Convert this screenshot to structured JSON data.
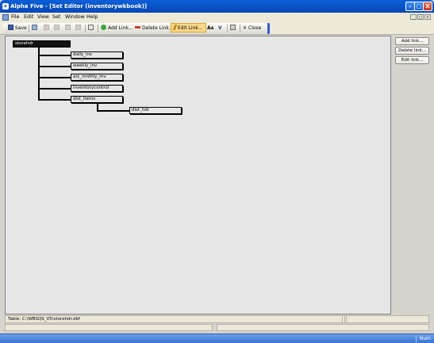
{
  "window": {
    "title": "Alpha Five - [Set Editor (inventorywkbook)]",
    "controls": {
      "minimize": "–",
      "maximize": "□",
      "close": "X"
    }
  },
  "menu": {
    "items": [
      "File",
      "Edit",
      "View",
      "Set",
      "Window",
      "Help"
    ],
    "mdi_controls": [
      "_",
      "◻",
      "x"
    ]
  },
  "toolbar": {
    "save": "Save",
    "add_link": "Add Link...",
    "delete_link": "Delete Link...",
    "edit_link": "Edit Link...",
    "close": "Close",
    "font_glyph": "Aᴀ",
    "v_glyph": "V"
  },
  "tree": {
    "root": "storehdr",
    "children": [
      "daily_inv",
      "weekly_inv",
      "arc_mnthly_inv",
      "inventorycontrol",
      "dist_items"
    ],
    "grandchild": "dist_hdr"
  },
  "side_buttons": {
    "add": "Add link...",
    "delete": "Delete link...",
    "edit": "Edit link..."
  },
  "status": {
    "table_path": "Table: C:\\WBSQS_V5\\storehdr.dbf",
    "indicator": "Num"
  },
  "colors": {
    "titlebar": "#0646b4",
    "active_tool": "#fbd88a",
    "canvas": "#e6e6e6"
  }
}
